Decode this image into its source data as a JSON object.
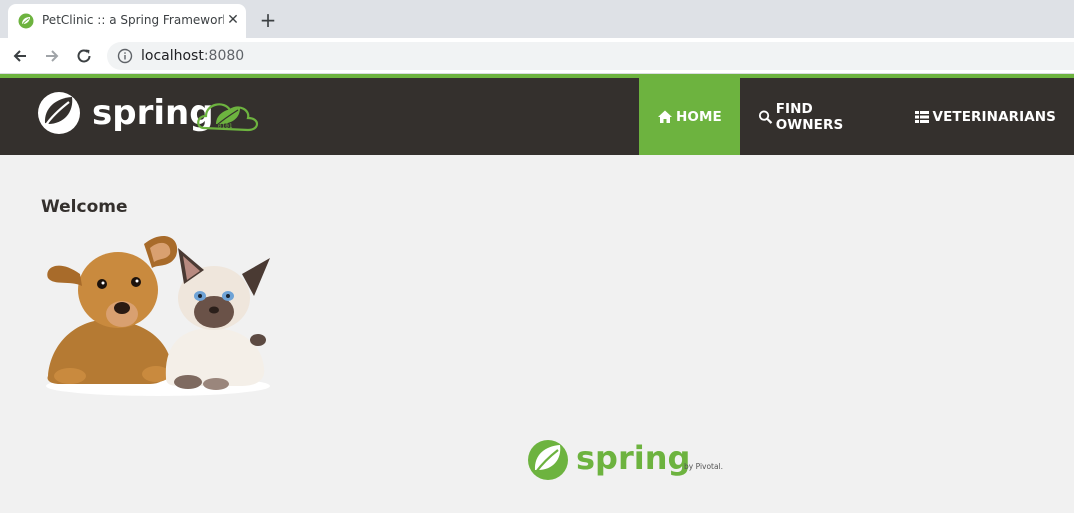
{
  "browser": {
    "tab_title": "PetClinic :: a Spring Framework",
    "tab_close": "✕",
    "new_tab": "+",
    "url_host": "localhost",
    "url_port": ":8080"
  },
  "navbar": {
    "brand_text": "spring",
    "items": [
      {
        "label": "HOME",
        "icon": "home-icon",
        "active": true
      },
      {
        "label": "FIND OWNERS",
        "icon": "search-icon",
        "active": false
      },
      {
        "label": "VETERINARIANS",
        "icon": "list-icon",
        "active": false
      }
    ]
  },
  "main": {
    "heading": "Welcome",
    "image_alt": "pets"
  },
  "footer": {
    "logo_text": "spring",
    "by_text": "by Pivotal."
  },
  "colors": {
    "accent": "#6db33f",
    "navbar_bg": "#34302d",
    "page_bg": "#f1f1f1"
  }
}
